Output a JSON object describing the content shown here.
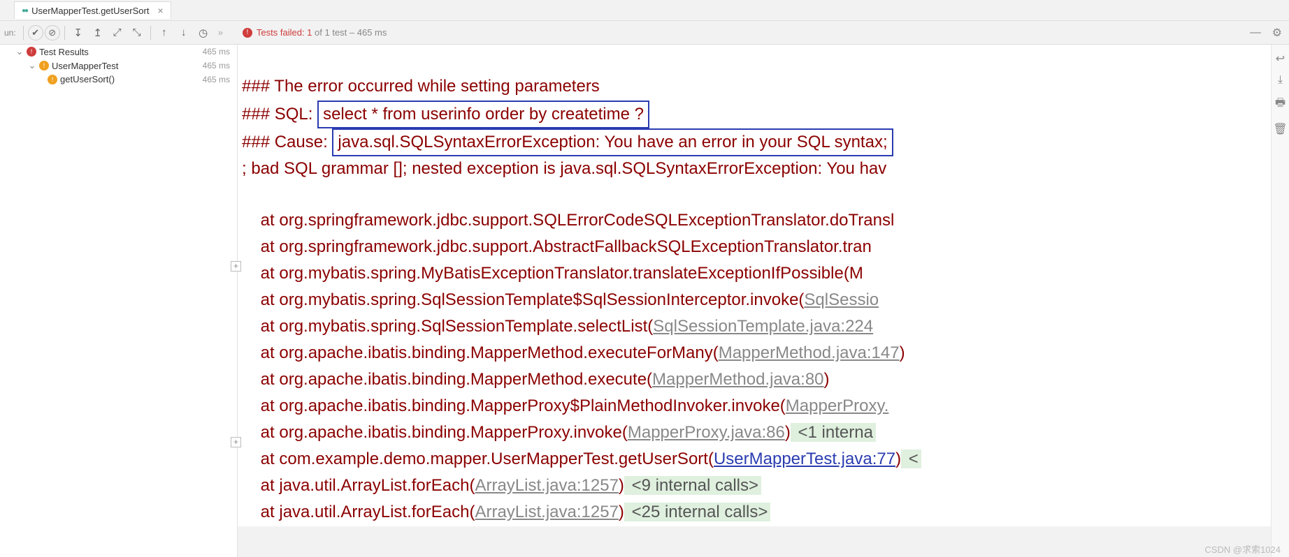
{
  "tab": {
    "label": "UserMapperTest.getUserSort",
    "close": "×"
  },
  "run_label": "un:",
  "summary": {
    "failed": "Tests failed: 1",
    "rest": " of 1 test – 465 ms"
  },
  "tree": {
    "root": {
      "label": "Test Results",
      "time": "465 ms"
    },
    "class": {
      "label": "UserMapperTest",
      "time": "465 ms"
    },
    "method": {
      "label": "getUserSort()",
      "time": "465 ms"
    }
  },
  "console": {
    "l1": "### The error occurred while setting parameters",
    "l2_pre": "### SQL: ",
    "l2_box": "select * from userinfo order by createtime ?",
    "l3_pre": "### Cause: ",
    "l3_box": "java.sql.SQLSyntaxErrorException: You have an error in your SQL syntax;",
    "l4": "; bad SQL grammar []; nested exception is java.sql.SQLSyntaxErrorException: You hav",
    "t1": "    at org.springframework.jdbc.support.SQLErrorCodeSQLExceptionTranslator.doTransl",
    "t2": "    at org.springframework.jdbc.support.AbstractFallbackSQLExceptionTranslator.tran",
    "t3": "    at org.mybatis.spring.MyBatisExceptionTranslator.translateExceptionIfPossible(M",
    "t4_a": "    at org.mybatis.spring.SqlSessionTemplate$SqlSessionInterceptor.invoke(",
    "t4_l": "SqlSessio",
    "t5_a": "    at org.mybatis.spring.SqlSessionTemplate.selectList(",
    "t5_l": "SqlSessionTemplate.java:224",
    "t6_a": "    at org.apache.ibatis.binding.MapperMethod.executeForMany(",
    "t6_l": "MapperMethod.java:147",
    "t6_e": ")",
    "t7_a": "    at org.apache.ibatis.binding.MapperMethod.execute(",
    "t7_l": "MapperMethod.java:80",
    "t7_e": ")",
    "t8_a": "    at org.apache.ibatis.binding.MapperProxy$PlainMethodInvoker.invoke(",
    "t8_l": "MapperProxy.",
    "t9_a": "    at org.apache.ibatis.binding.MapperProxy.invoke(",
    "t9_l": "MapperProxy.java:86",
    "t9_e": ")",
    "t9_c": " <1 interna",
    "t10_a": "    at com.example.demo.mapper.UserMapperTest.getUserSort(",
    "t10_l": "UserMapperTest.java:77",
    "t10_e": ")",
    "t10_c": " <",
    "t11_a": "    at java.util.ArrayList.forEach(",
    "t11_l": "ArrayList.java:1257",
    "t11_e": ")",
    "t11_c": " <9 internal calls>",
    "t12_a": "    at java.util.ArrayList.forEach(",
    "t12_l": "ArrayList.java:1257",
    "t12_e": ")",
    "t12_c": " <25 internal calls>"
  },
  "watermark": "CSDN @求索1024"
}
